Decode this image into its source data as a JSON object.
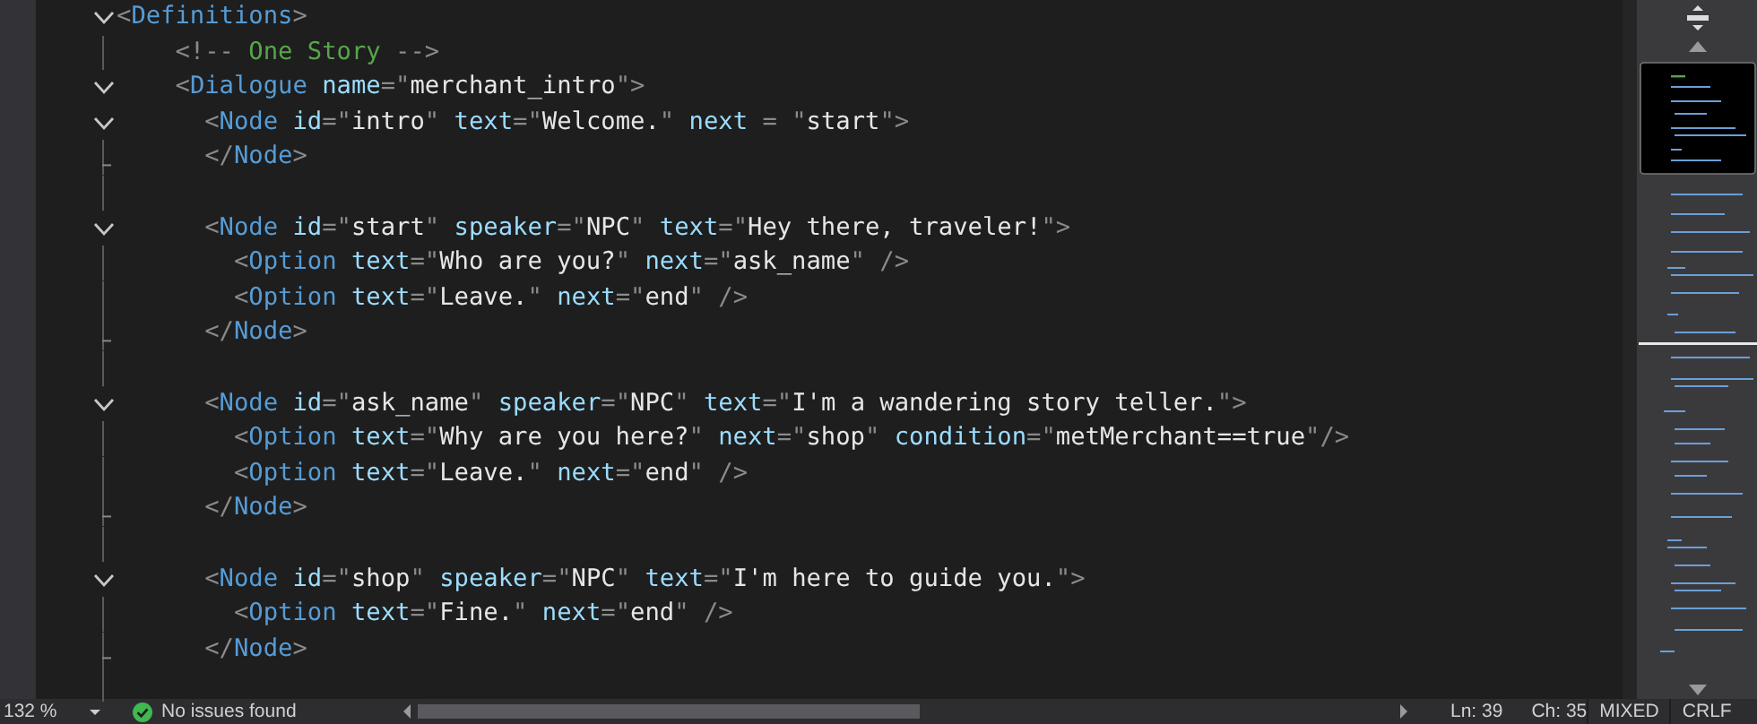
{
  "editor": {
    "lines": [
      {
        "kind": "code",
        "text": "<Definitions>",
        "fold": true
      },
      {
        "kind": "code",
        "text": "    <!-- One Story -->",
        "fold": false,
        "fold_end": false
      },
      {
        "kind": "code",
        "text": "    <Dialogue name=\"merchant_intro\">",
        "fold": true
      },
      {
        "kind": "code",
        "text": "      <Node id=\"intro\" text=\"Welcome.\" next = \"start\">",
        "fold": true
      },
      {
        "kind": "code",
        "text": "      </Node>",
        "fold": false,
        "fold_end": true
      },
      {
        "kind": "blank",
        "fold": false,
        "fold_end": false
      },
      {
        "kind": "code",
        "text": "      <Node id=\"start\" speaker=\"NPC\" text=\"Hey there, traveler!\">",
        "fold": true
      },
      {
        "kind": "code",
        "text": "        <Option text=\"Who are you?\" next=\"ask_name\" />",
        "fold": false,
        "fold_end": false
      },
      {
        "kind": "code",
        "text": "        <Option text=\"Leave.\" next=\"end\" />",
        "fold": false,
        "fold_end": false
      },
      {
        "kind": "code",
        "text": "      </Node>",
        "fold": false,
        "fold_end": true
      },
      {
        "kind": "blank",
        "fold": false,
        "fold_end": false
      },
      {
        "kind": "code",
        "text": "      <Node id=\"ask_name\" speaker=\"NPC\" text=\"I'm a wandering story teller.\">",
        "fold": true
      },
      {
        "kind": "code",
        "text": "        <Option text=\"Why are you here?\" next=\"shop\" condition=\"metMerchant==true\"/>",
        "fold": false,
        "fold_end": false
      },
      {
        "kind": "code",
        "text": "        <Option text=\"Leave.\" next=\"end\" />",
        "fold": false,
        "fold_end": false
      },
      {
        "kind": "code",
        "text": "      </Node>",
        "fold": false,
        "fold_end": true
      },
      {
        "kind": "blank",
        "fold": false,
        "fold_end": false
      },
      {
        "kind": "code",
        "text": "      <Node id=\"shop\" speaker=\"NPC\" text=\"I'm here to guide you.\">",
        "fold": true
      },
      {
        "kind": "code",
        "text": "        <Option text=\"Fine.\" next=\"end\" />",
        "fold": false,
        "fold_end": false
      },
      {
        "kind": "code",
        "text": "      </Node>",
        "fold": false,
        "fold_end": true
      },
      {
        "kind": "blank",
        "fold": false,
        "fold_end": false
      }
    ]
  },
  "status_bar": {
    "zoom": "132 %",
    "issues": "No issues found",
    "line": "Ln: 39",
    "char": "Ch: 35",
    "whitespace": "MIXED",
    "line_ending": "CRLF"
  }
}
